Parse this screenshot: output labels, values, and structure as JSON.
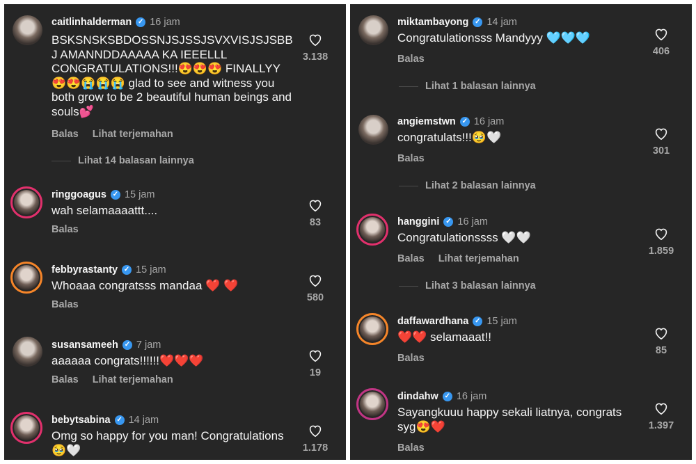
{
  "left": [
    {
      "username": "caitlinhalderman",
      "time": "16 jam",
      "text": "BSKSNSKSBDOSSNJSJSSJSVXVISJSJSBBJ AMANNDDAAAAA KA IEEELLL CONGRATULATIONS!!!😍😍😍 FINALLYY 😍😍😭😭😭 glad to see and witness you both grow to be 2 beautiful human beings and souls💕",
      "actions": [
        "Balas",
        "Lihat terjemahan"
      ],
      "replies": "Lihat 14 balasan lainnya",
      "likes": "3.138"
    },
    {
      "username": "ringgoagus",
      "time": "15 jam",
      "text": "wah selamaaaattt....",
      "actions": [
        "Balas"
      ],
      "replies": "",
      "likes": "83"
    },
    {
      "username": "febbyrastanty",
      "time": "15 jam",
      "text": "Whoaaa congratsss mandaa ❤️ ❤️",
      "actions": [
        "Balas"
      ],
      "replies": "",
      "likes": "580"
    },
    {
      "username": "susansameeh",
      "time": "7 jam",
      "text": "aaaaaa congrats!!!!!!❤️❤️❤️",
      "actions": [
        "Balas",
        "Lihat terjemahan"
      ],
      "replies": "",
      "likes": "19"
    },
    {
      "username": "bebytsabina",
      "time": "14 jam",
      "text": "Omg so happy for you man! Congratulations🥹🤍",
      "actions": [],
      "replies": "",
      "likes": "1.178"
    }
  ],
  "right": [
    {
      "username": "miktambayong",
      "time": "14 jam",
      "text": "Congratulationsss Mandyyy 🩵🩵🩵",
      "actions": [
        "Balas"
      ],
      "replies": "Lihat 1 balasan lainnya",
      "likes": "406"
    },
    {
      "username": "angiemstwn",
      "time": "16 jam",
      "text": "congratulats!!!🥹🤍",
      "actions": [
        "Balas"
      ],
      "replies": "Lihat 2 balasan lainnya",
      "likes": "301"
    },
    {
      "username": "hanggini",
      "time": "16 jam",
      "text": "Congratulationssss 🤍🤍",
      "actions": [
        "Balas",
        "Lihat terjemahan"
      ],
      "replies": "Lihat 3 balasan lainnya",
      "likes": "1.859"
    },
    {
      "username": "daffawardhana",
      "time": "15 jam",
      "text": "❤️❤️ selamaaat!!",
      "actions": [
        "Balas"
      ],
      "replies": "",
      "likes": "85"
    },
    {
      "username": "dindahw",
      "time": "16 jam",
      "text": "Sayangkuuu happy sekali liatnya, congrats syg😍❤️",
      "actions": [
        "Balas"
      ],
      "replies": "",
      "likes": "1.397"
    }
  ],
  "colors": {
    "background": "#262626",
    "text": "#f5f5f5",
    "muted": "#a8a8a8",
    "verified": "#3897f0"
  }
}
